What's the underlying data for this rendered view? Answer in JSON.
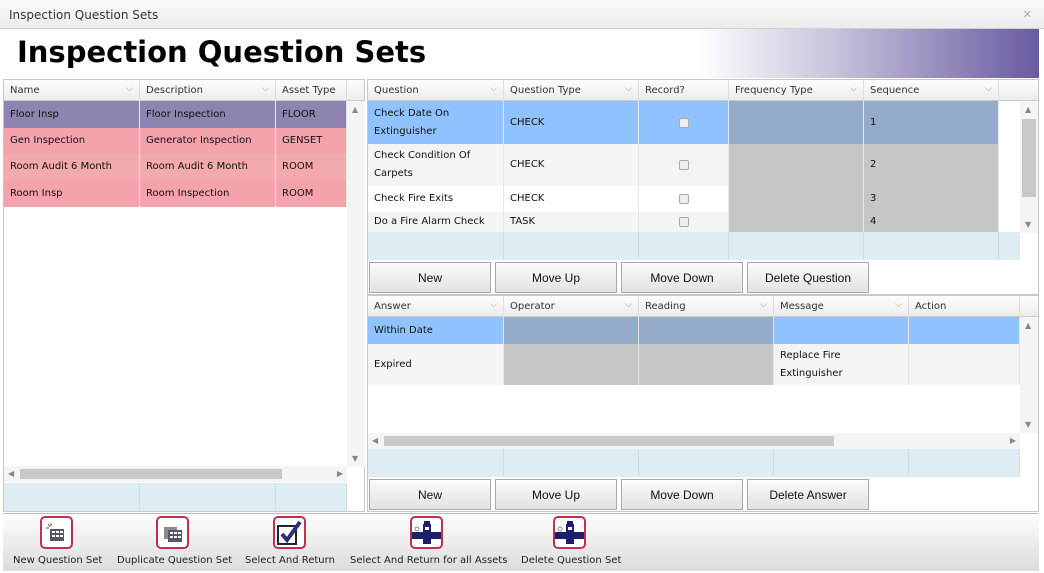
{
  "window": {
    "title": "Inspection Question Sets",
    "close_icon": "close-icon"
  },
  "header": {
    "title": "Inspection Question Sets",
    "accent": "#6a5aa0"
  },
  "sets_grid": {
    "columns": [
      "Name",
      "Description",
      "Asset Type"
    ],
    "rows": [
      {
        "cells": [
          "Floor Insp",
          "Floor Inspection",
          "FLOOR"
        ],
        "color": "#8f84b0",
        "selected": true
      },
      {
        "cells": [
          "Gen Inspection",
          "Generator Inspection",
          "GENSET"
        ],
        "color": "#f4a3ad"
      },
      {
        "cells": [
          "Room Audit 6 Month",
          "Room Audit 6 Month",
          "ROOM"
        ],
        "color": "#f3aaaf"
      },
      {
        "cells": [
          "Room Insp",
          "Room Inspection",
          "ROOM"
        ],
        "color": "#f4a3ad"
      }
    ]
  },
  "questions_grid": {
    "columns": [
      "Question",
      "Question Type",
      "Record?",
      "Frequency Type",
      "Sequence"
    ],
    "rows": [
      {
        "cells": [
          "Check Date On Extinguisher",
          "CHECK",
          "",
          "",
          "1"
        ],
        "record": false,
        "selected": true
      },
      {
        "cells": [
          "Check Condition Of Carpets",
          "CHECK",
          "",
          "",
          "2"
        ],
        "record": false
      },
      {
        "cells": [
          "Check Fire Exits",
          "CHECK",
          "",
          "",
          "3"
        ],
        "record": false
      },
      {
        "cells": [
          "Do a Fire Alarm Check",
          "TASK",
          "",
          "",
          "4"
        ],
        "record": false
      }
    ],
    "buttons": [
      "New",
      "Move Up",
      "Move Down",
      "Delete Question"
    ]
  },
  "answers_grid": {
    "columns": [
      "Answer",
      "Operator",
      "Reading",
      "Message",
      "Action"
    ],
    "rows": [
      {
        "cells": [
          "Within Date",
          "",
          "",
          "",
          ""
        ],
        "selected": true
      },
      {
        "cells": [
          "Expired",
          "",
          "",
          "Replace Fire Extinguisher",
          ""
        ]
      }
    ],
    "buttons": [
      "New",
      "Move Up",
      "Move Down",
      "Delete Answer"
    ]
  },
  "toolbar": [
    {
      "label": "New Question Set",
      "icon": "new-grid-icon"
    },
    {
      "label": "Duplicate Question Set",
      "icon": "duplicate-grid-icon"
    },
    {
      "label": "Select And Return",
      "icon": "checkmark-icon"
    },
    {
      "label": "Select And Return for all Assets",
      "icon": "pipe-valve-icon"
    },
    {
      "label": "Delete Question Set",
      "icon": "pipe-valve-icon"
    }
  ]
}
